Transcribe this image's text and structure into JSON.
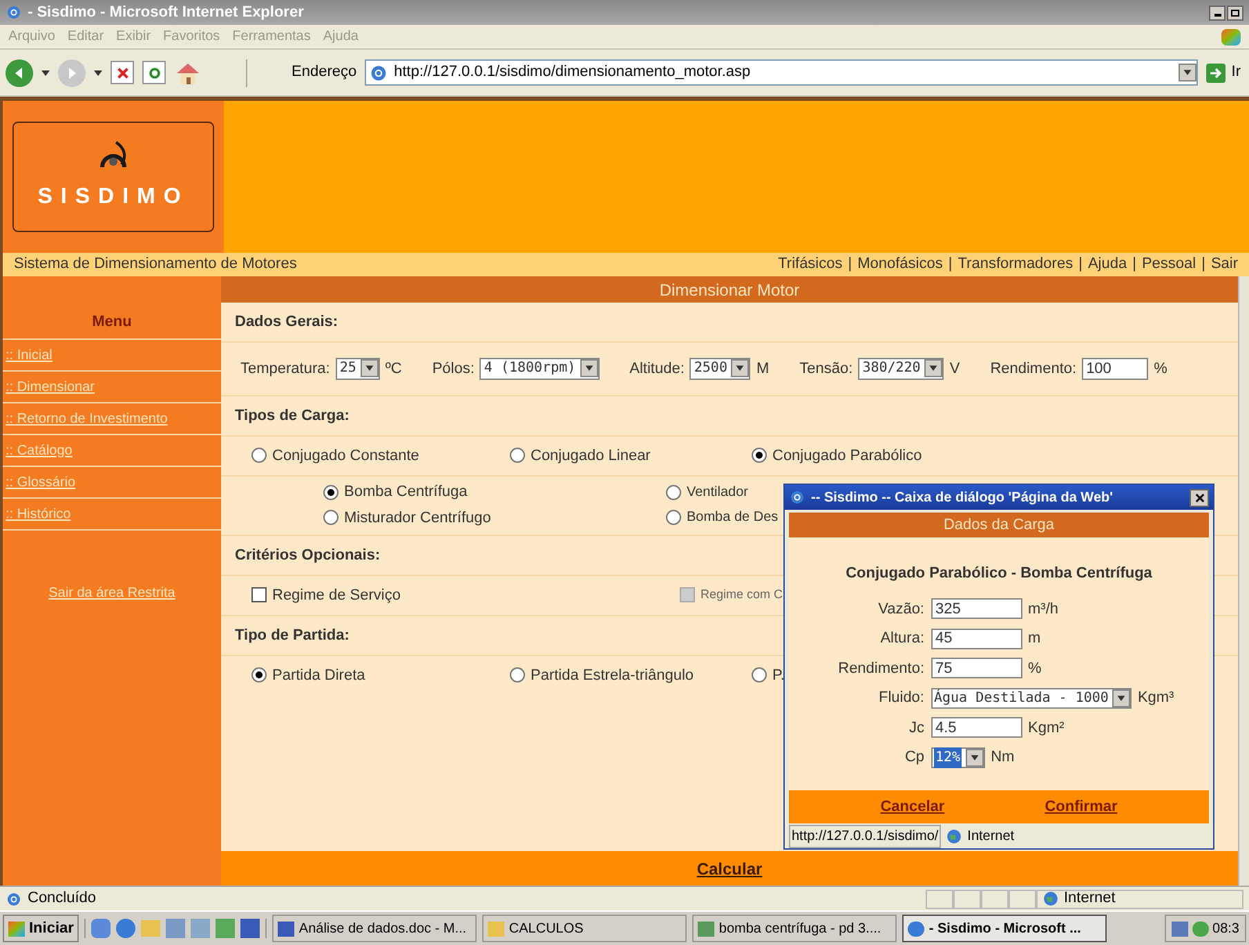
{
  "window": {
    "title": "- Sisdimo - Microsoft Internet Explorer"
  },
  "menu_bar": [
    "Arquivo",
    "Editar",
    "Exibir",
    "Favoritos",
    "Ferramentas",
    "Ajuda"
  ],
  "toolbar": {
    "address_label": "Endereço",
    "url": "http://127.0.0.1/sisdimo/dimensionamento_motor.asp",
    "go": "Ir"
  },
  "header": {
    "logo_text": "SISDIMO"
  },
  "system_bar": {
    "title": "Sistema de Dimensionamento de Motores",
    "separator": "|",
    "links": [
      "Trifásicos",
      "Monofásicos",
      "Transformadores",
      "Ajuda",
      "Pessoal",
      "Sair"
    ]
  },
  "sidebar": {
    "title": "Menu",
    "items": [
      ":: Inicial",
      ":: Dimensionar",
      ":: Retorno de Investimento",
      ":: Catálogo",
      ":: Glossário",
      ":: Histórico"
    ],
    "logout": "Sair da área Restrita"
  },
  "page_title": "Dimensionar Motor",
  "dados_gerais": {
    "title": "Dados Gerais:",
    "fields": [
      {
        "label": "Temperatura:",
        "value": "25",
        "unit": "ºC",
        "kind": "select"
      },
      {
        "label": "Pólos:",
        "value": "4 (1800rpm)",
        "kind": "select"
      },
      {
        "label": "Altitude:",
        "value": "2500",
        "unit": "M",
        "kind": "select"
      },
      {
        "label": "Tensão:",
        "value": "380/220",
        "unit": "V",
        "kind": "select"
      },
      {
        "label": "Rendimento:",
        "value": "100",
        "unit": "%",
        "kind": "input"
      }
    ]
  },
  "tipos_de_carga": {
    "title": "Tipos de Carga:",
    "options": [
      {
        "label": "Conjugado Constante",
        "selected": false
      },
      {
        "label": "Conjugado Linear",
        "selected": false
      },
      {
        "label": "Conjugado Parabólico",
        "selected": true
      }
    ],
    "sub_options": [
      {
        "label": "Bomba Centrífuga",
        "selected": true
      },
      {
        "label": "Ventilador",
        "selected": false
      },
      {
        "label": "Misturador Centrífugo",
        "selected": false
      },
      {
        "label": "Bomba de Des",
        "selected": false
      }
    ]
  },
  "criterios_opcionais": {
    "title": "Critérios Opcionais:",
    "options": [
      {
        "label": "Regime de Serviço",
        "checked": false,
        "disabled": false
      },
      {
        "label": "Regime com C",
        "checked": false,
        "disabled": true
      }
    ]
  },
  "tipo_de_partida": {
    "title": "Tipo de Partida:",
    "options": [
      {
        "label": "Partida Direta",
        "selected": true
      },
      {
        "label": "Partida Estrela-triângulo",
        "selected": false
      },
      {
        "label": "P.",
        "selected": false
      }
    ]
  },
  "calculate_button": "Calcular",
  "dialog": {
    "title": "-- Sisdimo -- Caixa de diálogo 'Página da Web'",
    "header": "Dados da Carga",
    "subtitle": "Conjugado Parabólico - Bomba Centrífuga",
    "fields": [
      {
        "label": "Vazão:",
        "value": "325",
        "unit": "m³/h",
        "kind": "input",
        "highlighted": false
      },
      {
        "label": "Altura:",
        "value": "45",
        "unit": "m",
        "kind": "input",
        "highlighted": false
      },
      {
        "label": "Rendimento:",
        "value": "75",
        "unit": "%",
        "kind": "input",
        "highlighted": false
      },
      {
        "label": "Fluido:",
        "value": "Água Destilada - 1000",
        "unit": "Kgm³",
        "kind": "select",
        "highlighted": false
      },
      {
        "label": "Jc",
        "value": "4.5",
        "unit": "Kgm²",
        "kind": "input",
        "highlighted": false
      },
      {
        "label": "Cp",
        "value": "12%",
        "unit": "Nm",
        "kind": "select",
        "highlighted": true
      }
    ],
    "buttons": [
      "Cancelar",
      "Confirmar"
    ],
    "status_url": "http://127.0.0.1/sisdimo/",
    "status_zone": "Internet"
  },
  "status_bar": {
    "text": "Concluído",
    "zone": "Internet"
  },
  "taskbar": {
    "start": "Iniciar",
    "tasks": [
      {
        "label": "Análise de dados.doc - M...",
        "kind": "doc",
        "selected": false
      },
      {
        "label": "CALCULOS",
        "kind": "folder",
        "selected": false
      },
      {
        "label": "bomba centrífuga - pd 3....",
        "kind": "image",
        "selected": false
      },
      {
        "label": "- Sisdimo - Microsoft ...",
        "kind": "browser",
        "selected": true
      }
    ],
    "clock": "08:3"
  }
}
